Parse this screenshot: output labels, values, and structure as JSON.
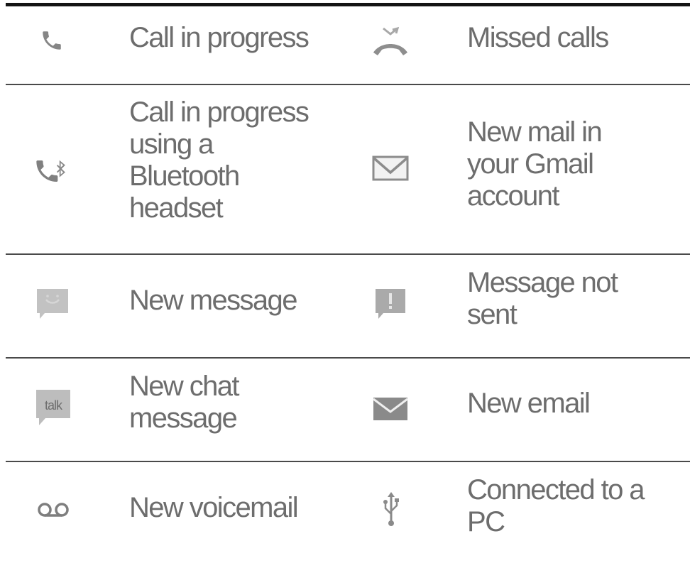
{
  "rows": [
    {
      "left": {
        "icon": "phone-icon",
        "label": "Call in progress"
      },
      "right": {
        "icon": "missed-call-icon",
        "label": "Missed calls"
      }
    },
    {
      "left": {
        "icon": "bluetooth-phone-icon",
        "label": "Call in progress\nusing a\nBluetooth\nheadset"
      },
      "right": {
        "icon": "gmail-icon",
        "label": "New mail in\nyour Gmail\naccount"
      }
    },
    {
      "left": {
        "icon": "new-message-icon",
        "label": "New message"
      },
      "right": {
        "icon": "message-not-sent-icon",
        "label": "Message not\nsent"
      }
    },
    {
      "left": {
        "icon": "talk-icon",
        "label": "New chat\nmessage",
        "icon_text": "talk"
      },
      "right": {
        "icon": "email-icon",
        "label": "New email"
      }
    },
    {
      "left": {
        "icon": "voicemail-icon",
        "label": "New voicemail"
      },
      "right": {
        "icon": "usb-icon",
        "label": "Connected to a\nPC"
      }
    }
  ],
  "colors": {
    "text": "#6d6d6d",
    "icon": "#8a8a8a",
    "icon_light": "#b5b5b5",
    "rule": "#4a4a4a",
    "top_rule": "#141414"
  }
}
